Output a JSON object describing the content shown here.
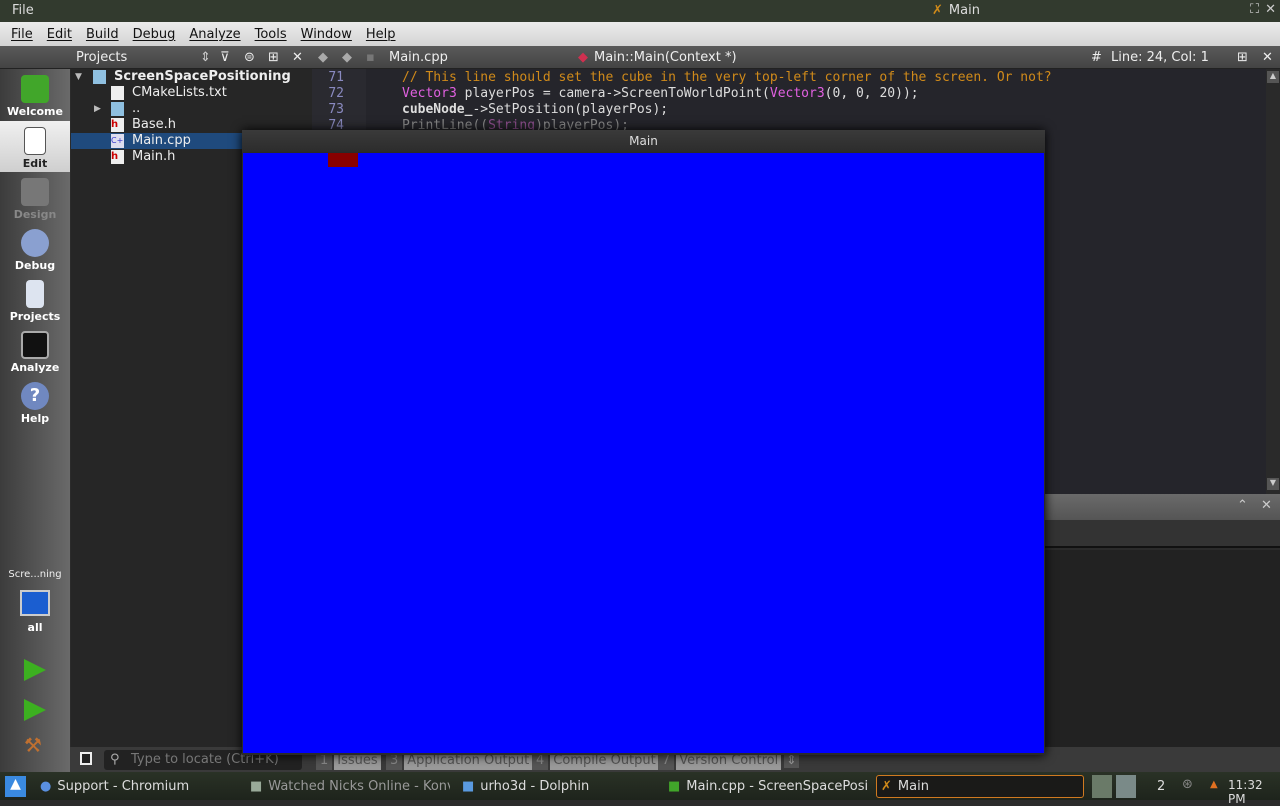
{
  "titlebar": {
    "left": "File",
    "title": "Main"
  },
  "menu": [
    "File",
    "Edit",
    "Build",
    "Debug",
    "Analyze",
    "Tools",
    "Window",
    "Help"
  ],
  "projects_panel": {
    "title": "Projects"
  },
  "editor_toolbar": {
    "file": "Main.cpp",
    "symbol": "Main::Main(Context *)",
    "position": "Line: 24, Col: 1",
    "hash": "#"
  },
  "modes": [
    {
      "label": "Welcome"
    },
    {
      "label": "Edit"
    },
    {
      "label": "Design"
    },
    {
      "label": "Debug"
    },
    {
      "label": "Projects"
    },
    {
      "label": "Analyze"
    },
    {
      "label": "Help"
    }
  ],
  "kit": {
    "project": "Scre...ning",
    "config": "all"
  },
  "tree": [
    {
      "label": "ScreenSpacePositioning",
      "type": "project"
    },
    {
      "label": "CMakeLists.txt",
      "type": "txt"
    },
    {
      "label": "..",
      "type": "folder"
    },
    {
      "label": "Base.h",
      "type": "h"
    },
    {
      "label": "Main.cpp",
      "type": "cpp",
      "selected": true
    },
    {
      "label": "Main.h",
      "type": "h"
    }
  ],
  "code": {
    "lines": [
      71,
      72,
      73,
      74
    ],
    "l71": "// This line should set the cube in the very top-left corner of the screen. Or not?",
    "l72a": "Vector3",
    "l72b": " playerPos = camera->ScreenToWorldPoint(",
    "l72c": "Vector3",
    "l72d": "(0, 0, 20));",
    "l73a": "cubeNode_",
    "l73b": "->SetPosition(playerPos);",
    "l74a": "PrintLine((",
    "l74b": "String",
    "l74c": ")playerPos);"
  },
  "bottom": {
    "locate_placeholder": "Type to locate (Ctrl+K)",
    "tabs": [
      {
        "n": "1",
        "label": "Issues"
      },
      {
        "n": "3",
        "label": "Application Output"
      },
      {
        "n": "4",
        "label": "Compile Output"
      },
      {
        "n": "7",
        "label": "Version Control"
      }
    ]
  },
  "main_window": {
    "title": "Main",
    "bg": "#0000ff",
    "cube": "#880000"
  },
  "taskbar": {
    "tasks": [
      "Support - Chromium",
      "Watched Nicks Online - Konv",
      "urho3d - Dolphin",
      "Main.cpp - ScreenSpacePosi",
      "Main"
    ],
    "desktop": "2",
    "clock": "11:32 PM"
  }
}
